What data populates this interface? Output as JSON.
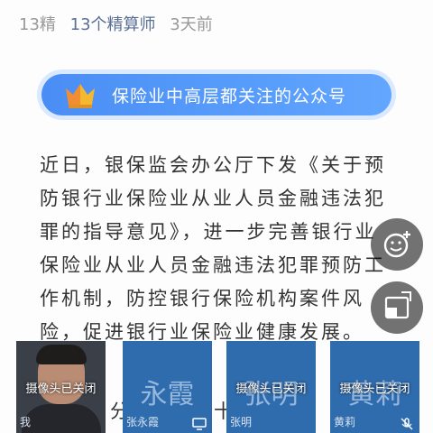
{
  "meta": {
    "count": "13精",
    "author": "13个精算师",
    "time": "3天前"
  },
  "banner": {
    "label": "保险业中高层都关注的公众号",
    "icon": "crown-icon",
    "color": "#4a8ef5"
  },
  "article": {
    "lines": [
      "近日，银保监会办公厅下发《关于预",
      "防银行业保险业从业人员金融违法犯",
      "罪的指导意见》，进一步完善银行业",
      "保险业从业人员金融违法犯罪预防工",
      "作机制，防控银行保险机构案件风",
      "险，促进银行业保险业健康发展。"
    ],
    "partial": {
      "fen": "分",
      "plus": "十"
    }
  },
  "video": {
    "self": {
      "caption": "我",
      "status": "摄像头已关闭"
    },
    "participants": [
      {
        "bigname": "永霞",
        "caption": "张永霞",
        "status": "",
        "icon": "screen-share-icon"
      },
      {
        "bigname": "张明",
        "caption": "张明",
        "status": "摄像头已关闭",
        "icon": ""
      },
      {
        "bigname": "黄莉",
        "caption": "黄莉",
        "status": "摄像头已关闭",
        "icon": "mic-muted-icon"
      }
    ]
  }
}
